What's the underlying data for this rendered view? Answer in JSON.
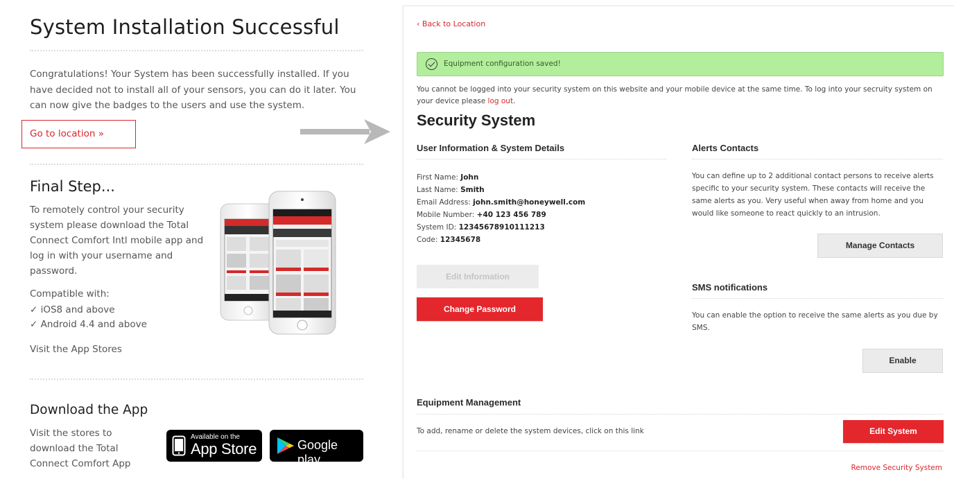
{
  "left": {
    "title": "System Installation Successful",
    "intro_lines": [
      "Congratulations! Your System has been successfully installed. If you",
      "have decided not to install all of your sensors, you can do it later. You",
      "can now give the badges to the users and use the system."
    ],
    "go_to_location": "Go to location »",
    "final_step": {
      "heading": "Final Step...",
      "lines": [
        "To remotely control your security",
        "system please download the Total",
        "Connect Comfort Intl mobile app and",
        "log in with your username and",
        "password."
      ],
      "compatible_label": "Compatible with:",
      "compat": [
        "✓  iOS8 and above",
        "✓  Android 4.4 and above"
      ],
      "visit": "Visit the App Stores"
    },
    "download": {
      "heading": "Download the App",
      "lines": [
        "Visit the stores to",
        "download the Total",
        "Connect Comfort App"
      ],
      "appstore_small": "Available on the",
      "appstore_big": "App Store",
      "gplay": "Google play"
    }
  },
  "right": {
    "back": "‹ Back to Location",
    "alert": "Equipment configuration saved!",
    "note_lines": [
      "You cannot be logged into your security system on this website and your mobile device at the same time. To log into your secruity system on",
      "your device please "
    ],
    "note_link": "log out",
    "note_end": ".",
    "title": "Security System",
    "user_info": {
      "heading": "User Information & System Details",
      "rows": [
        {
          "label": "First Name: ",
          "value": "John"
        },
        {
          "label": "Last Name: ",
          "value": "Smith"
        },
        {
          "label": "Email Address: ",
          "value": "john.smith@honeywell.com"
        },
        {
          "label": "Mobile Number: ",
          "value": "+40 123 456 789"
        },
        {
          "label": "System ID: ",
          "value": "12345678910111213"
        },
        {
          "label": "Code: ",
          "value": "12345678"
        }
      ],
      "edit_btn": "Edit Information",
      "password_btn": "Change Password"
    },
    "alerts": {
      "heading": "Alerts Contacts",
      "desc_lines": [
        "You can define up to 2 additional contact persons to receive alerts",
        "specific to your security system. These contacts will receive the",
        "same alerts as you. Very useful when away from home and you",
        "would like someone to react quickly to an intrusion."
      ],
      "btn": "Manage Contacts"
    },
    "sms": {
      "heading": "SMS notifications",
      "desc_lines": [
        "You can enable the option to receive the same alerts as you due by",
        "SMS."
      ],
      "btn": "Enable"
    },
    "equipment": {
      "heading": "Equipment Management",
      "desc": "To add, rename or delete the system devices, click on this link",
      "btn": "Edit System"
    },
    "remove": "Remove Security System"
  },
  "colors": {
    "brand_red": "#e3272d",
    "link_red": "#d8262d",
    "success_green": "#b2ee9c"
  }
}
